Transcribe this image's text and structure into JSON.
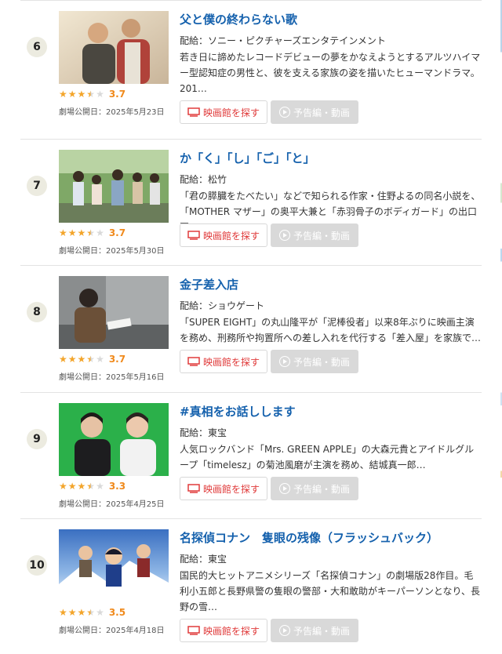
{
  "labels": {
    "theater_button": "映画館を探す",
    "trailer_button": "予告編・動画"
  },
  "colors": {
    "title": "#1561ad",
    "score": "#f08a1c",
    "star": "#f3a52b",
    "theater_button_text": "#e03b3b"
  },
  "entries": [
    {
      "rank": "6",
      "title": "父と僕の終わらない歌",
      "distributor": "配給：ソニー・ピクチャーズエンタテインメント",
      "description": "若き日に諦めたレコードデビューの夢をかなえようとするアルツハイマー型認知症の男性と、彼を支える家族の姿を描いたヒューマンドラマ。201…",
      "rating": 3.7,
      "rating_text": "3.7",
      "release": "劇場公開日：2025年5月23日",
      "thumb_icon": "father-son-photo"
    },
    {
      "rank": "7",
      "title": "か「く」「し」「ご」「と」",
      "distributor": "配給：松竹",
      "description": "「君の膵臓をたべたい」などで知られる作家・住野よるの同名小説を、「MOTHER マザー」の奥平大兼と「赤羽骨子のボディガード」の出口夏…",
      "rating": 3.7,
      "rating_text": "3.7",
      "release": "劇場公開日：2025年5月30日",
      "thumb_icon": "students-photo"
    },
    {
      "rank": "8",
      "title": "金子差入店",
      "distributor": "配給：ショウゲート",
      "description": "「SUPER EIGHT」の丸山隆平が「泥棒役者」以来8年ぶりに映画主演を務め、刑務所や拘置所への差し入れを代行する「差入屋」を家族で…",
      "rating": 3.7,
      "rating_text": "3.7",
      "release": "劇場公開日：2025年5月16日",
      "thumb_icon": "man-reading-photo"
    },
    {
      "rank": "9",
      "title": "#真相をお話しします",
      "distributor": "配給：東宝",
      "description": "人気ロックバンド「Mrs. GREEN APPLE」の大森元貴とアイドルグループ「timelesz」の菊池風磨が主演を務め、結城真一郎…",
      "rating": 3.3,
      "rating_text": "3.3",
      "release": "劇場公開日：2025年4月25日",
      "thumb_icon": "two-men-green-photo"
    },
    {
      "rank": "10",
      "title": "名探偵コナン　隻眼の残像（フラッシュバック）",
      "distributor": "配給：東宝",
      "description": "国民的大ヒットアニメシリーズ「名探偵コナン」の劇場版28作目。毛利小五郎と長野県警の隻眼の警部・大和敢助がキーパーソンとなり、長野の雪…",
      "rating": 3.5,
      "rating_text": "3.5",
      "release": "劇場公開日：2025年4月18日",
      "thumb_icon": "anime-poster"
    }
  ]
}
